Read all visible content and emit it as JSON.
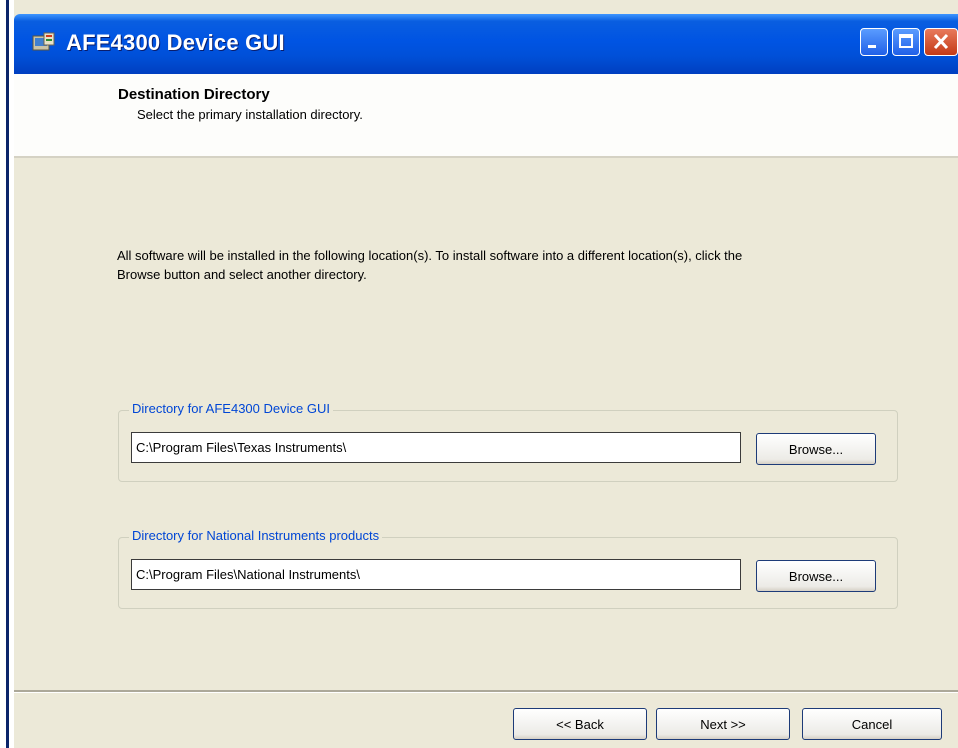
{
  "window": {
    "title": "AFE4300 Device GUI",
    "app_icon": "installer-icon",
    "controls": [
      "minimize-icon",
      "maximize-icon",
      "close-icon"
    ]
  },
  "header": {
    "title": "Destination Directory",
    "subtitle": "Select the primary installation directory."
  },
  "intro_text": "All software will be installed in the following location(s). To install software into a different location(s), click the Browse button and select another directory.",
  "directories": [
    {
      "label": "Directory for AFE4300 Device GUI",
      "path": "C:\\Program Files\\Texas Instruments\\",
      "browse_label": "Browse..."
    },
    {
      "label": "Directory for National Instruments products",
      "path": "C:\\Program Files\\National Instruments\\",
      "browse_label": "Browse..."
    }
  ],
  "buttons": {
    "back": "<< Back",
    "next": "Next >>",
    "cancel": "Cancel"
  },
  "colors": {
    "titlebar": "#0054e3",
    "dialog_bg": "#ece9d8",
    "group_label": "#0046d5",
    "close_button": "#c43a16"
  }
}
